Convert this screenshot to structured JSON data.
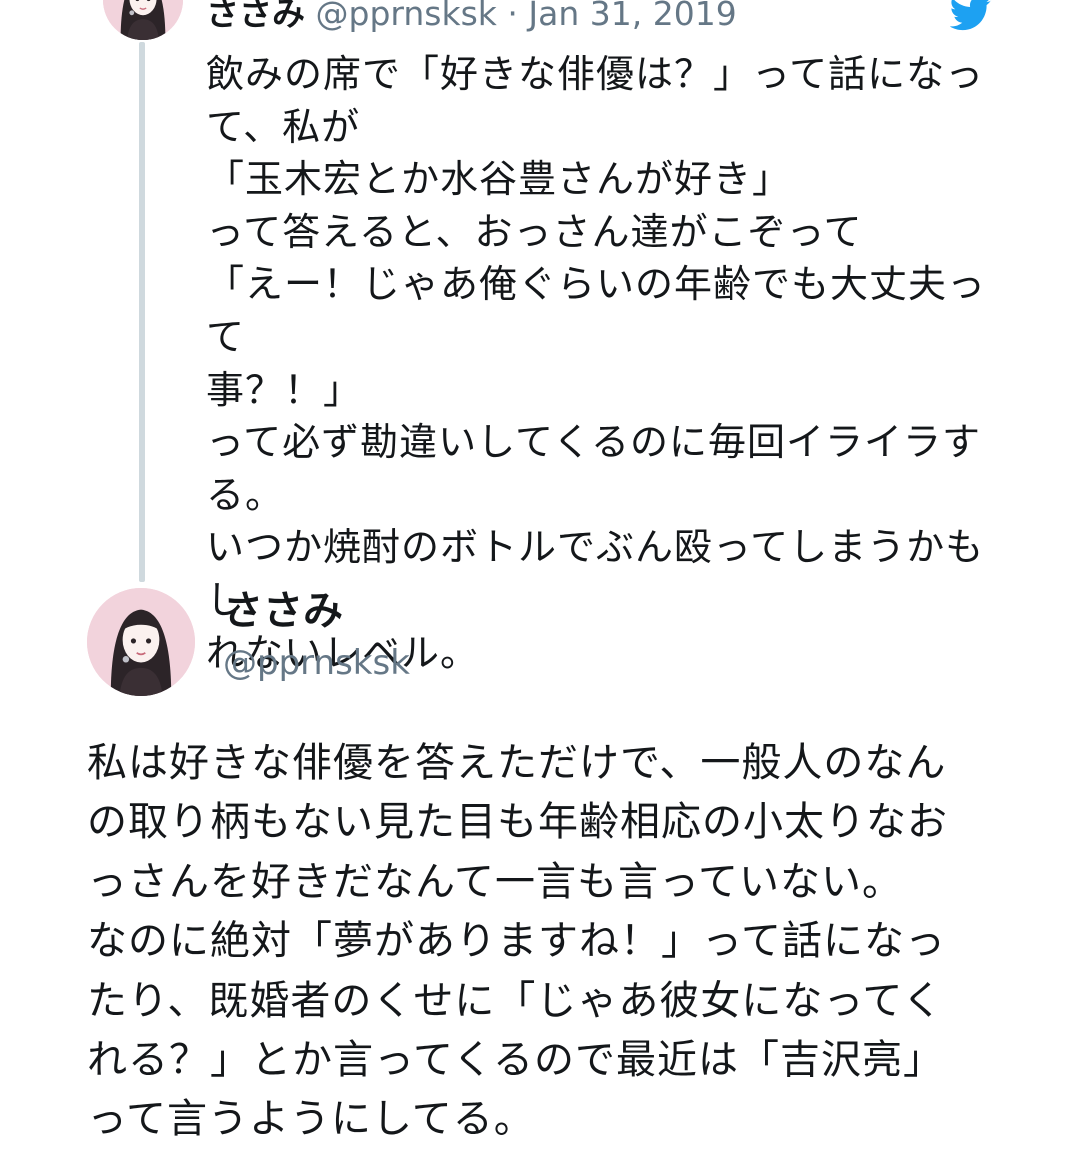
{
  "reply_tweet": {
    "display_name": "ささみ",
    "handle": "@pprnsksk",
    "separator": " · ",
    "date": "Jan 31, 2019",
    "text": "飲みの席で「好きな俳優は？」って話になっ\nて、私が\n「玉木宏とか水谷豊さんが好き」\nって答えると、おっさん達がこぞって\n「えー！じゃあ俺ぐらいの年齢でも大丈夫って\n事？！」\nって必ず勘違いしてくるのに毎回イライラす\nる。\nいつか焼酎のボトルでぶん殴ってしまうかもし\nれないレベル。"
  },
  "main_tweet": {
    "display_name": "ささみ",
    "handle": "@pprnsksk",
    "text": "私は好きな俳優を答えただけで、一般人のなん\nの取り柄もない見た目も年齢相応の小太りなお\nっさんを好きだなんて一言も言っていない。\nなのに絶対「夢がありますね！」って話になっ\nたり、既婚者のくせに「じゃあ彼女になってく\nれる？」とか言ってくるので最近は「吉沢亮」\nって言うようにしてる。"
  },
  "icons": {
    "brand": "twitter-bird-icon",
    "avatar": "anime-girl-avatar"
  },
  "colors": {
    "twitter_blue": "#1da1f2",
    "text": "#14171a",
    "secondary_text": "#657786",
    "thread_line": "#cfd9de",
    "avatar_bg": "#f4d6de"
  }
}
